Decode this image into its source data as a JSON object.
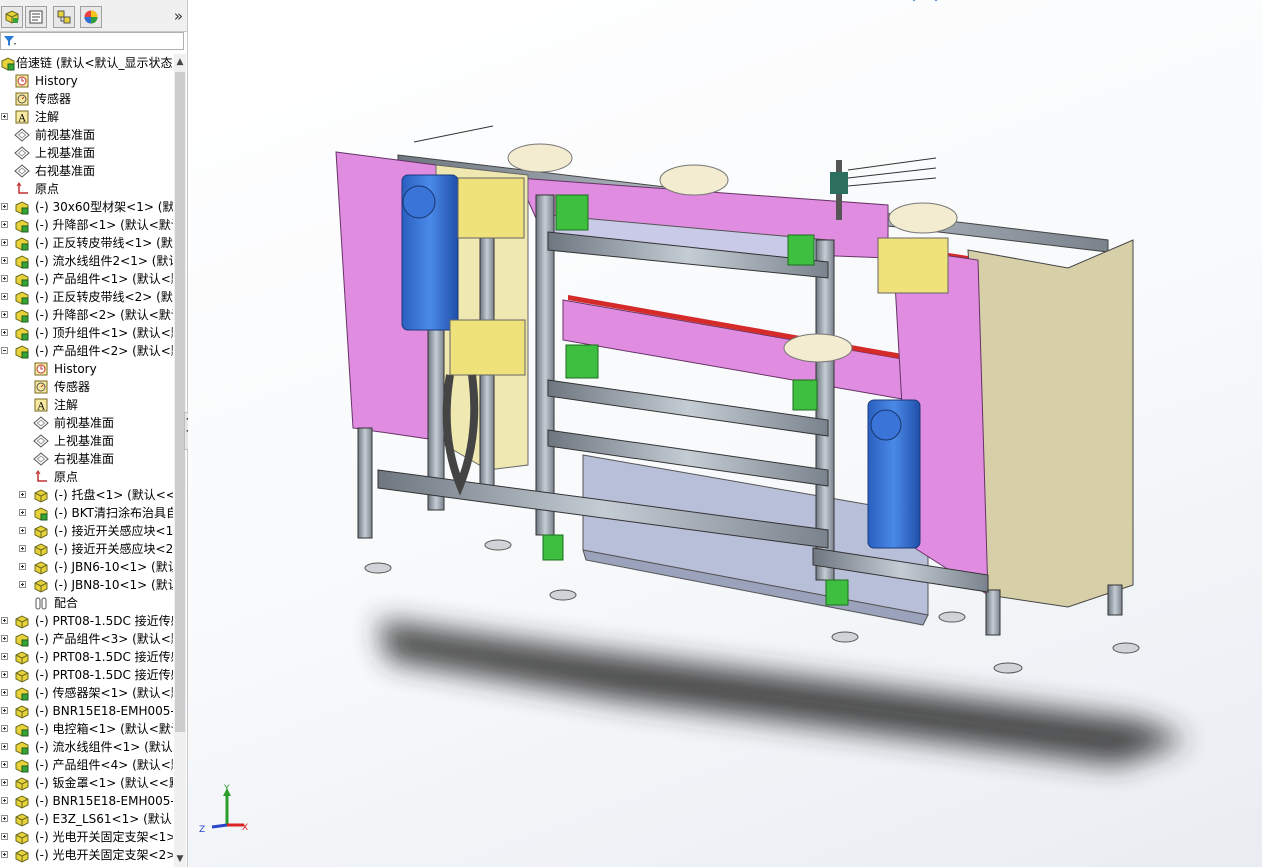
{
  "feature_tree": {
    "tabs": [
      {
        "name": "feature-manager-tab"
      },
      {
        "name": "property-manager-tab"
      },
      {
        "name": "configuration-manager-tab"
      },
      {
        "name": "display-manager-tab"
      }
    ],
    "more_tabs": "»",
    "items": [
      {
        "label": "倍速链  (默认<默认_显示状态",
        "icon": "assembly",
        "level": 0,
        "expander": "minus"
      },
      {
        "label": "History",
        "icon": "history",
        "level": 1,
        "expander": ""
      },
      {
        "label": "传感器",
        "icon": "sensor",
        "level": 1,
        "expander": ""
      },
      {
        "label": "注解",
        "icon": "annotation",
        "level": 1,
        "expander": "plus"
      },
      {
        "label": "前视基准面",
        "icon": "plane",
        "level": 1,
        "expander": ""
      },
      {
        "label": "上视基准面",
        "icon": "plane",
        "level": 1,
        "expander": ""
      },
      {
        "label": "右视基准面",
        "icon": "plane",
        "level": 1,
        "expander": ""
      },
      {
        "label": "原点",
        "icon": "origin",
        "level": 1,
        "expander": ""
      },
      {
        "label": "(-) 30x60型材架<1> (默认",
        "icon": "subassembly",
        "level": 1,
        "expander": "plus"
      },
      {
        "label": "(-) 升降部<1> (默认<默认",
        "icon": "subassembly",
        "level": 1,
        "expander": "plus"
      },
      {
        "label": "(-) 正反转皮带线<1> (默",
        "icon": "subassembly",
        "level": 1,
        "expander": "plus"
      },
      {
        "label": "(-) 流水线组件2<1> (默认",
        "icon": "subassembly",
        "level": 1,
        "expander": "plus"
      },
      {
        "label": "(-) 产品组件<1> (默认<默",
        "icon": "subassembly",
        "level": 1,
        "expander": "plus"
      },
      {
        "label": "(-) 正反转皮带线<2> (默",
        "icon": "subassembly",
        "level": 1,
        "expander": "plus"
      },
      {
        "label": "(-) 升降部<2> (默认<默认",
        "icon": "subassembly",
        "level": 1,
        "expander": "plus"
      },
      {
        "label": "(-) 顶升组件<1> (默认<默",
        "icon": "subassembly",
        "level": 1,
        "expander": "plus"
      },
      {
        "label": "(-) 产品组件<2> (默认<默",
        "icon": "subassembly",
        "level": 1,
        "expander": "minus"
      },
      {
        "label": "History",
        "icon": "history",
        "level": 2,
        "expander": ""
      },
      {
        "label": "传感器",
        "icon": "sensor",
        "level": 2,
        "expander": ""
      },
      {
        "label": "注解",
        "icon": "annotation",
        "level": 2,
        "expander": ""
      },
      {
        "label": "前视基准面",
        "icon": "plane",
        "level": 2,
        "expander": ""
      },
      {
        "label": "上视基准面",
        "icon": "plane",
        "level": 2,
        "expander": ""
      },
      {
        "label": "右视基准面",
        "icon": "plane",
        "level": 2,
        "expander": ""
      },
      {
        "label": "原点",
        "icon": "origin",
        "level": 2,
        "expander": ""
      },
      {
        "label": "(-) 托盘<1> (默认<<默",
        "icon": "part",
        "level": 2,
        "expander": "plus"
      },
      {
        "label": "(-) BKT清扫涂布治具自",
        "icon": "subassembly",
        "level": 2,
        "expander": "plus"
      },
      {
        "label": "(-) 接近开关感应块<1",
        "icon": "part",
        "level": 2,
        "expander": "plus"
      },
      {
        "label": "(-) 接近开关感应块<2",
        "icon": "part",
        "level": 2,
        "expander": "plus"
      },
      {
        "label": "(-) JBN6-10<1> (默认",
        "icon": "part",
        "level": 2,
        "expander": "plus"
      },
      {
        "label": "(-) JBN8-10<1> (默认",
        "icon": "part",
        "level": 2,
        "expander": "plus"
      },
      {
        "label": "配合",
        "icon": "mates",
        "level": 2,
        "expander": ""
      },
      {
        "label": "(-) PRT08-1.5DC 接近传感",
        "icon": "part",
        "level": 1,
        "expander": "plus"
      },
      {
        "label": "(-) 产品组件<3> (默认<默",
        "icon": "subassembly",
        "level": 1,
        "expander": "plus"
      },
      {
        "label": "(-) PRT08-1.5DC 接近传感",
        "icon": "part",
        "level": 1,
        "expander": "plus"
      },
      {
        "label": "(-) PRT08-1.5DC 接近传感",
        "icon": "part",
        "level": 1,
        "expander": "plus"
      },
      {
        "label": "(-) 传感器架<1> (默认<默",
        "icon": "subassembly",
        "level": 1,
        "expander": "plus"
      },
      {
        "label": "(-) BNR15E18-EMH005-",
        "icon": "part",
        "level": 1,
        "expander": "plus"
      },
      {
        "label": "(-) 电控箱<1> (默认<默认",
        "icon": "subassembly",
        "level": 1,
        "expander": "plus"
      },
      {
        "label": "(-) 流水线组件<1> (默认",
        "icon": "subassembly",
        "level": 1,
        "expander": "plus"
      },
      {
        "label": "(-) 产品组件<4> (默认<默",
        "icon": "subassembly",
        "level": 1,
        "expander": "plus"
      },
      {
        "label": "(-) 钣金罩<1> (默认<<默",
        "icon": "part",
        "level": 1,
        "expander": "plus"
      },
      {
        "label": "(-) BNR15E18-EMH005-",
        "icon": "part",
        "level": 1,
        "expander": "plus"
      },
      {
        "label": "(-) E3Z_LS61<1> (默认<",
        "icon": "part",
        "level": 1,
        "expander": "plus"
      },
      {
        "label": "(-) 光电开关固定支架<1>",
        "icon": "part",
        "level": 1,
        "expander": "plus"
      },
      {
        "label": "(-) 光电开关固定支架<2>",
        "icon": "part",
        "level": 1,
        "expander": "plus"
      }
    ]
  },
  "triad": {
    "x": "X",
    "y": "Y",
    "z": "Z"
  },
  "colors": {
    "frame": "#9aa3ad",
    "side_plate": "#e08ce0",
    "motor": "#3c78d8",
    "bracket": "#f0e27a",
    "green_block": "#3fbf3f",
    "cabinet": "#d7cfa8",
    "red_strip": "#d42a2a",
    "shadow": "#333333"
  }
}
